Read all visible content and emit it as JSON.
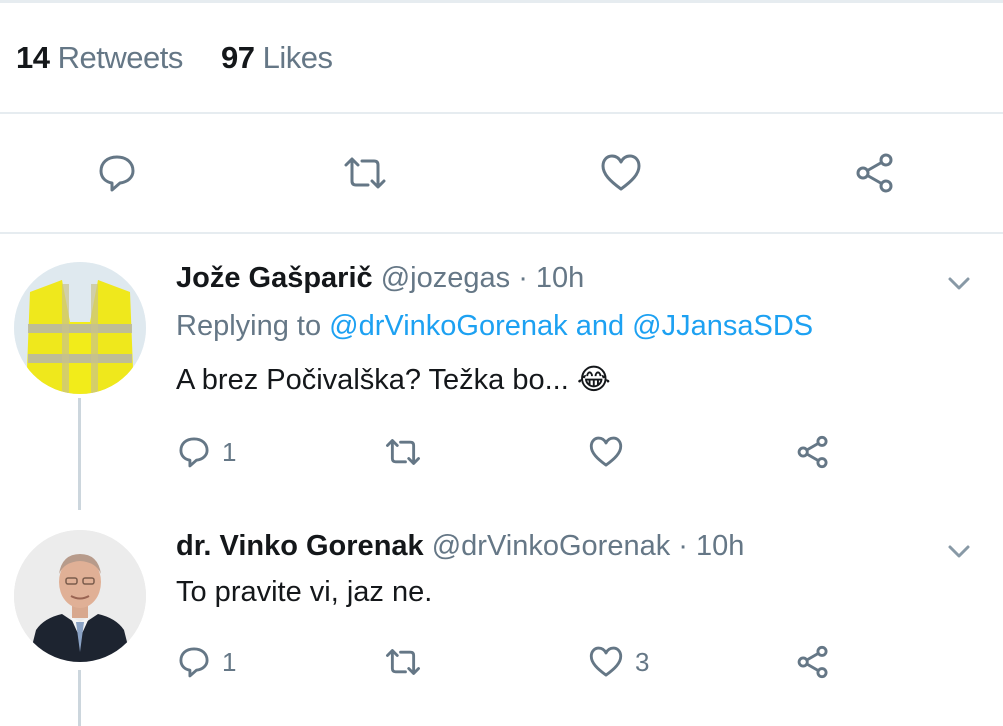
{
  "stats": {
    "retweets_count": "14",
    "retweets_label": "Retweets",
    "likes_count": "97",
    "likes_label": "Likes"
  },
  "main_actions": {
    "icons": [
      "reply-icon",
      "retweet-icon",
      "like-icon",
      "share-icon"
    ]
  },
  "replies": [
    {
      "name": "Jože Gašparič",
      "handle": "@jozegas",
      "dot": "·",
      "time": "10h",
      "replying_prefix": "Replying to",
      "replying_to_1": "@drVinkoGorenak",
      "replying_and": "and",
      "replying_to_2": "@JJansaSDS",
      "text": "A brez Počivalška? Težka bo...",
      "emoji": "😂",
      "reply_count": "1",
      "retweet_count": "",
      "like_count": ""
    },
    {
      "name": "dr. Vinko Gorenak",
      "handle": "@drVinkoGorenak",
      "dot": "·",
      "time": "10h",
      "text": "To pravite vi, jaz ne.",
      "reply_count": "1",
      "retweet_count": "",
      "like_count": "3"
    }
  ],
  "colors": {
    "accent": "#1da1f2",
    "muted": "#657786",
    "icon": "#657786",
    "divider": "#e6ecf0",
    "vest": "#f2ec1a"
  }
}
